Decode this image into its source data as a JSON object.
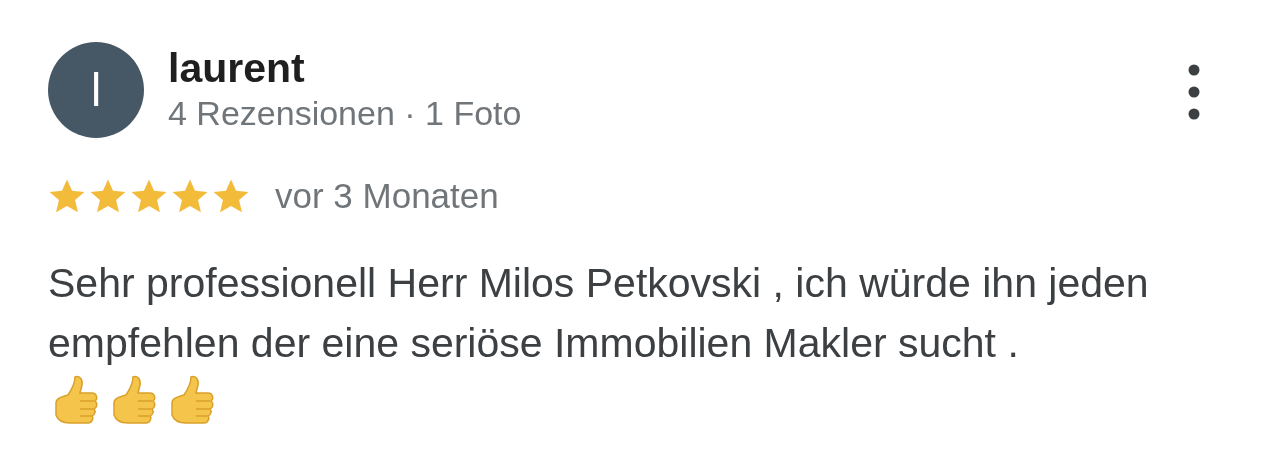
{
  "review": {
    "avatar_letter": "l",
    "author": "laurent",
    "meta": "4 Rezensionen · 1 Foto",
    "stars": 5,
    "time": "vor 3 Monaten",
    "text": "Sehr professionell Herr Milos Petkovski , ich würde ihn jeden empfehlen der eine seriöse Immobilien Makler sucht .",
    "reactions": [
      {
        "kind": "thumbs-up"
      },
      {
        "kind": "thumbs-up"
      },
      {
        "kind": "thumbs-up"
      }
    ]
  }
}
